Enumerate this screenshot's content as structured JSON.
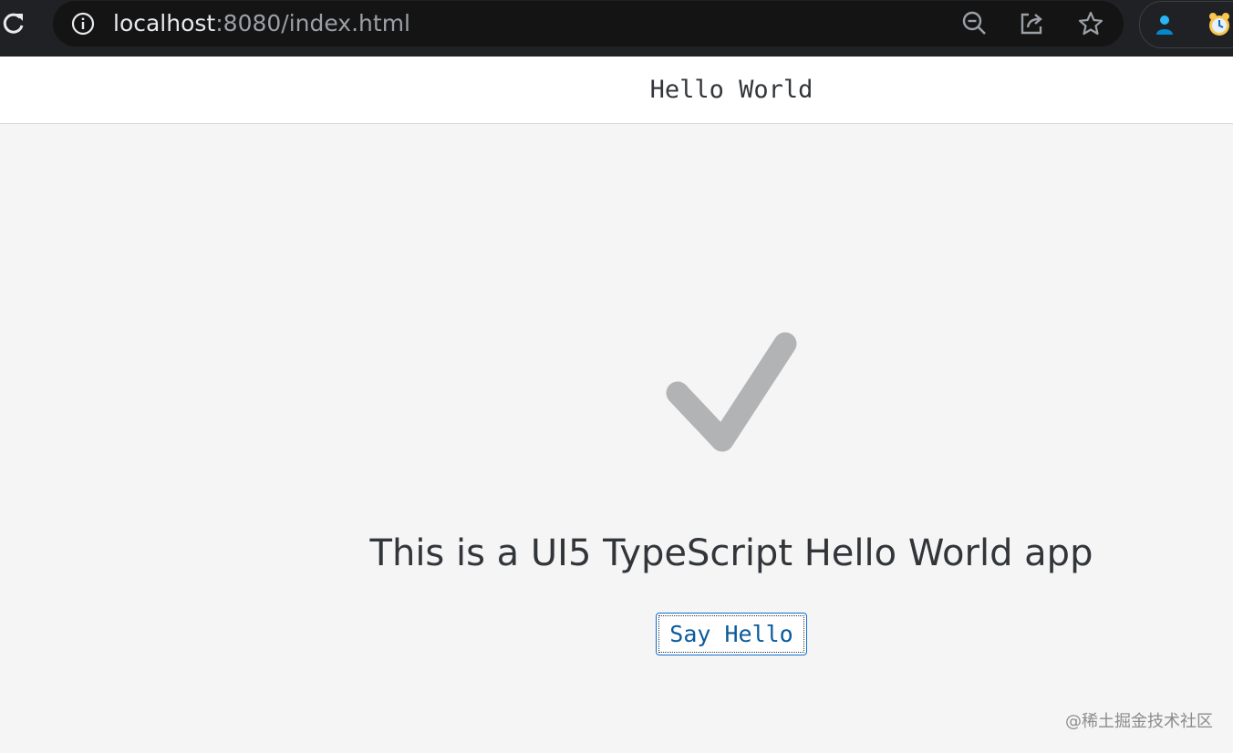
{
  "browser": {
    "url_host": "localhost",
    "url_rest": ":8080/index.html",
    "icons": [
      "reload-icon",
      "info-icon",
      "zoom-out-icon",
      "share-icon",
      "star-icon",
      "profile-extension-icon",
      "alarm-clock-extension-icon"
    ]
  },
  "app": {
    "title": "Hello World",
    "intro": "This is a UI5 TypeScript Hello World app",
    "button_label": "Say Hello",
    "accent_color": "#0a6ed1",
    "check_color": "#b2b3b4"
  },
  "watermark": "@稀土掘金技术社区"
}
